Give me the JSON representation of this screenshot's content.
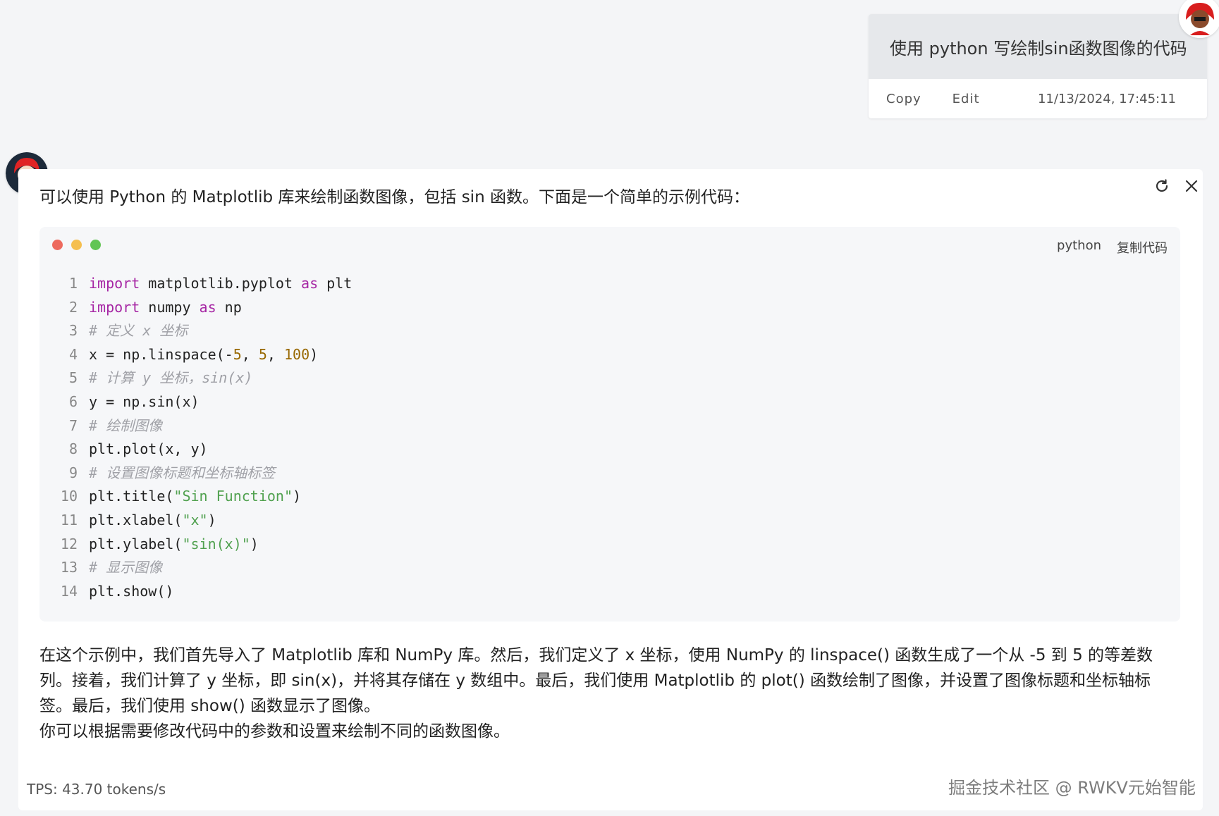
{
  "user": {
    "message": "使用 python 写绘制sin函数图像的代码",
    "copy_label": "Copy",
    "edit_label": "Edit",
    "timestamp": "11/13/2024, 17:45:11"
  },
  "assistant": {
    "intro": "可以使用 Python 的 Matplotlib 库来绘制函数图像，包括 sin 函数。下面是一个简单的示例代码：",
    "code": {
      "language": "python",
      "copy_label": "复制代码",
      "dot_colors": [
        "#ed6a5e",
        "#f5bf4f",
        "#61c554"
      ],
      "lines": [
        {
          "n": "1",
          "tokens": [
            {
              "t": "kw",
              "v": "import"
            },
            {
              "t": "plain",
              "v": " matplotlib.pyplot "
            },
            {
              "t": "kw",
              "v": "as"
            },
            {
              "t": "plain",
              "v": " plt"
            }
          ]
        },
        {
          "n": "2",
          "tokens": [
            {
              "t": "kw",
              "v": "import"
            },
            {
              "t": "plain",
              "v": " numpy "
            },
            {
              "t": "kw",
              "v": "as"
            },
            {
              "t": "plain",
              "v": " np"
            }
          ]
        },
        {
          "n": "3",
          "tokens": [
            {
              "t": "cm",
              "v": "# 定义 x 坐标"
            }
          ]
        },
        {
          "n": "4",
          "tokens": [
            {
              "t": "plain",
              "v": "x = np.linspace(-"
            },
            {
              "t": "num",
              "v": "5"
            },
            {
              "t": "plain",
              "v": ", "
            },
            {
              "t": "num",
              "v": "5"
            },
            {
              "t": "plain",
              "v": ", "
            },
            {
              "t": "num",
              "v": "100"
            },
            {
              "t": "plain",
              "v": ")"
            }
          ]
        },
        {
          "n": "5",
          "tokens": [
            {
              "t": "cm",
              "v": "# 计算 y 坐标，sin(x)"
            }
          ]
        },
        {
          "n": "6",
          "tokens": [
            {
              "t": "plain",
              "v": "y = np.sin(x)"
            }
          ]
        },
        {
          "n": "7",
          "tokens": [
            {
              "t": "cm",
              "v": "# 绘制图像"
            }
          ]
        },
        {
          "n": "8",
          "tokens": [
            {
              "t": "plain",
              "v": "plt.plot(x, y)"
            }
          ]
        },
        {
          "n": "9",
          "tokens": [
            {
              "t": "cm",
              "v": "# 设置图像标题和坐标轴标签"
            }
          ]
        },
        {
          "n": "10",
          "tokens": [
            {
              "t": "plain",
              "v": "plt.title("
            },
            {
              "t": "str",
              "v": "\"Sin Function\""
            },
            {
              "t": "plain",
              "v": ")"
            }
          ]
        },
        {
          "n": "11",
          "tokens": [
            {
              "t": "plain",
              "v": "plt.xlabel("
            },
            {
              "t": "str",
              "v": "\"x\""
            },
            {
              "t": "plain",
              "v": ")"
            }
          ]
        },
        {
          "n": "12",
          "tokens": [
            {
              "t": "plain",
              "v": "plt.ylabel("
            },
            {
              "t": "str",
              "v": "\"sin(x)\""
            },
            {
              "t": "plain",
              "v": ")"
            }
          ]
        },
        {
          "n": "13",
          "tokens": [
            {
              "t": "cm",
              "v": "# 显示图像"
            }
          ]
        },
        {
          "n": "14",
          "tokens": [
            {
              "t": "plain",
              "v": "plt.show()"
            }
          ]
        }
      ]
    },
    "explanation": [
      "在这个示例中，我们首先导入了 Matplotlib 库和 NumPy 库。然后，我们定义了 x 坐标，使用 NumPy 的 linspace() 函数生成了一个从 -5 到 5 的等差数列。接着，我们计算了 y 坐标，即 sin(x)，并将其存储在 y 数组中。最后，我们使用 Matplotlib 的 plot() 函数绘制了图像，并设置了图像标题和坐标轴标签。最后，我们使用 show() 函数显示了图像。",
      "你可以根据需要修改代码中的参数和设置来绘制不同的函数图像。"
    ],
    "tps": "TPS: 43.70 tokens/s"
  },
  "icons": {
    "refresh": "refresh-icon",
    "close": "close-icon"
  },
  "watermark": "掘金技术社区 @ RWKV元始智能"
}
